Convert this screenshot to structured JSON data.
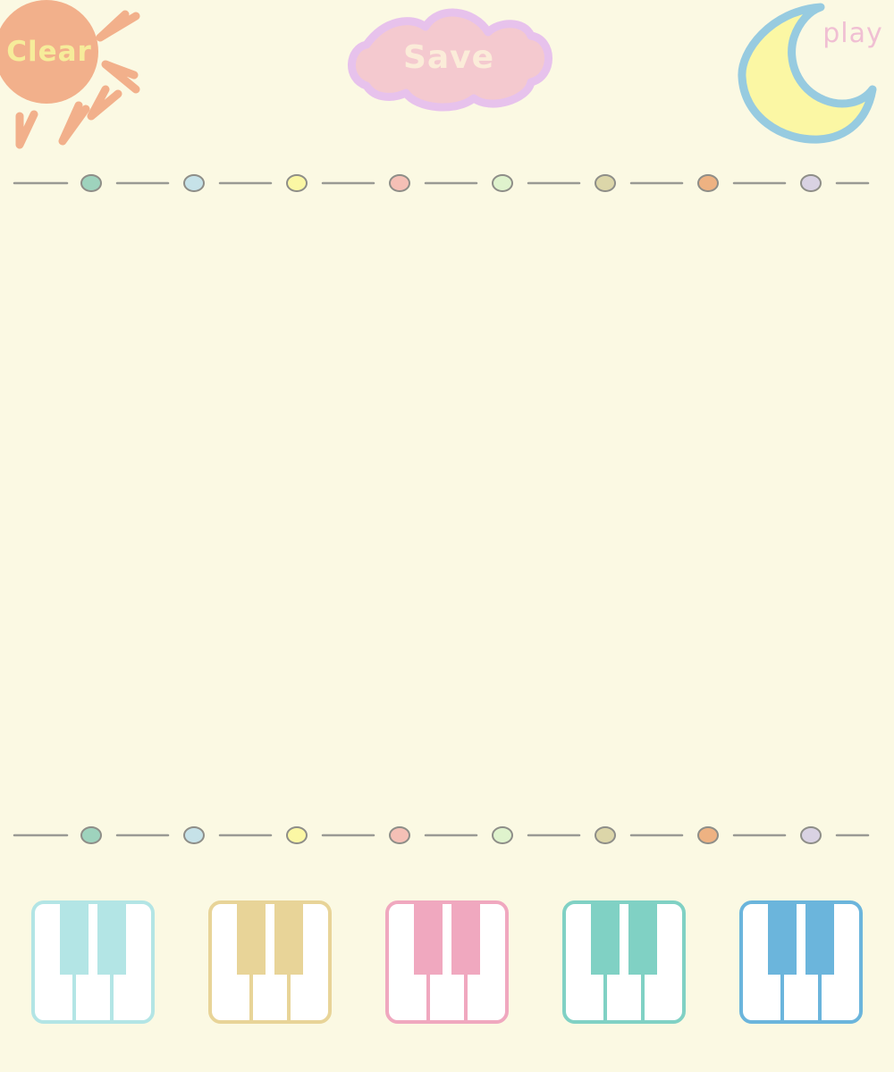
{
  "toolbar": {
    "clear_label": "Clear",
    "save_label": "Save",
    "play_label": "play"
  },
  "colors": {
    "background": "#fbf9e3",
    "sun": "#f2b08b",
    "cloud_fill": "#f4c9cf",
    "cloud_outline": "#e7c2ec",
    "moon_fill": "#fbf7a4",
    "moon_outline": "#97cbe0"
  },
  "timeline_dots": [
    {
      "name": "dot-1",
      "color": "#9ed3bd"
    },
    {
      "name": "dot-2",
      "color": "#c6e2e8"
    },
    {
      "name": "dot-3",
      "color": "#fbf7a4"
    },
    {
      "name": "dot-4",
      "color": "#f5c0b6"
    },
    {
      "name": "dot-5",
      "color": "#dff3cd"
    },
    {
      "name": "dot-6",
      "color": "#dcd6a9"
    },
    {
      "name": "dot-7",
      "color": "#eeb282"
    },
    {
      "name": "dot-8",
      "color": "#d9d2e3"
    }
  ],
  "instruments": [
    {
      "name": "piano-cyan",
      "color": "#b3e5e5"
    },
    {
      "name": "piano-gold",
      "color": "#e8d498"
    },
    {
      "name": "piano-pink",
      "color": "#f0a8bf"
    },
    {
      "name": "piano-teal",
      "color": "#80d1c4"
    },
    {
      "name": "piano-blue",
      "color": "#6bb5dc"
    }
  ]
}
